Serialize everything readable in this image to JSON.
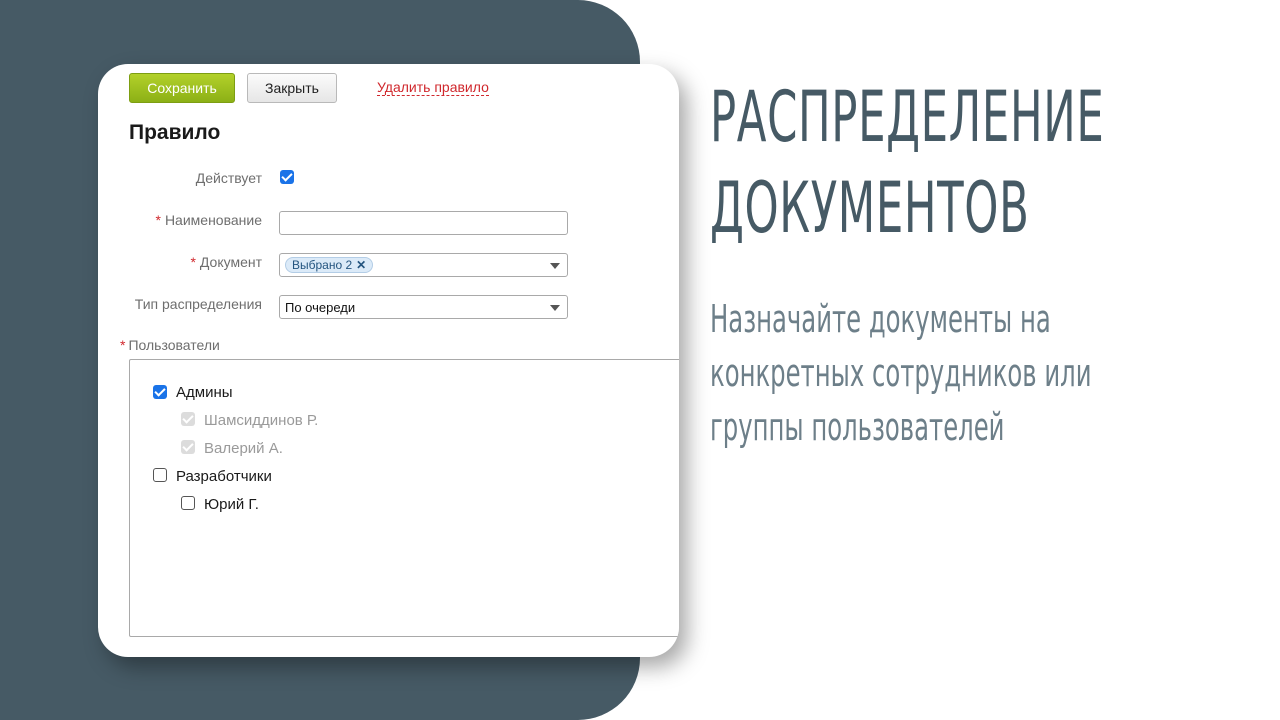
{
  "colors": {
    "panel_bg": "#465a65",
    "hero_title": "#465a65",
    "hero_subtitle": "#6d7f89",
    "save_button": "#9cc11e",
    "delete_link": "#d0282d",
    "checkbox_checked": "#1a73e8"
  },
  "toolbar": {
    "save_label": "Сохранить",
    "close_label": "Закрыть",
    "delete_label": "Удалить правило"
  },
  "form": {
    "title": "Правило",
    "active": {
      "label": "Действует",
      "checked": true
    },
    "name": {
      "label": "Наименование",
      "required_mark": "*",
      "value": ""
    },
    "document": {
      "label": "Документ",
      "required_mark": "*",
      "tag_label": "Выбрано 2",
      "tag_remove_icon": "close-x-icon"
    },
    "distribution_type": {
      "label": "Тип распределения",
      "value": "По очереди"
    },
    "users": {
      "label": "Пользователи",
      "required_mark": "*",
      "tree": [
        {
          "label": "Админы",
          "checked": true,
          "children": [
            {
              "label": "Шамсиддинов Р.",
              "checked": true,
              "disabled": true
            },
            {
              "label": "Валерий А.",
              "checked": true,
              "disabled": true
            }
          ]
        },
        {
          "label": "Разработчики",
          "checked": false,
          "children": [
            {
              "label": "Юрий Г.",
              "checked": false,
              "disabled": false
            }
          ]
        }
      ]
    }
  },
  "hero": {
    "title_line1": "РАСПРЕДЕЛЕНИЕ",
    "title_line2": "ДОКУМЕНТОВ",
    "subtitle_line1": "Назначайте документы на",
    "subtitle_line2": "конкретных сотрудников или",
    "subtitle_line3": "группы пользователей"
  }
}
